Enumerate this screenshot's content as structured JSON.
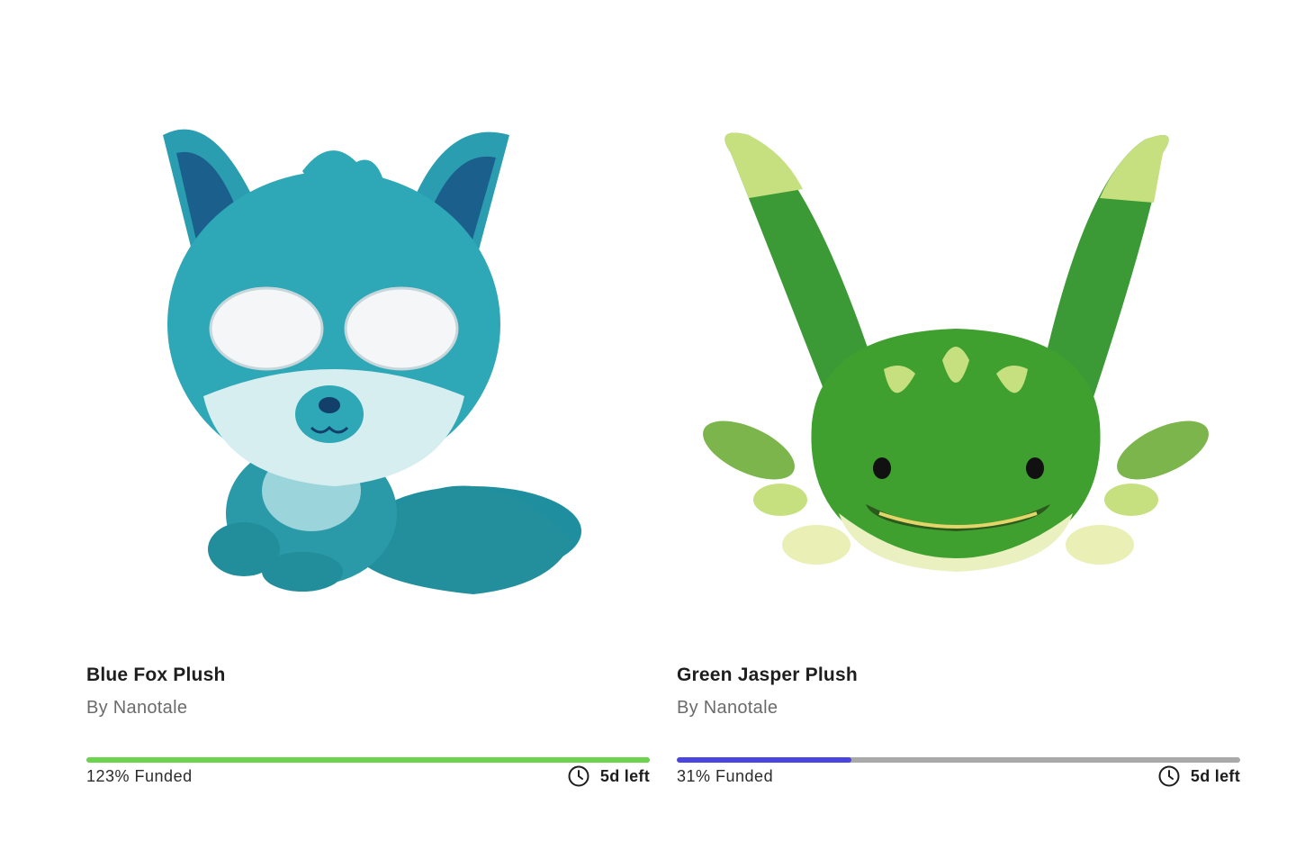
{
  "projects": [
    {
      "title": "Blue Fox Plush",
      "creator_label": "By Nanotale",
      "funded_label": "123% Funded",
      "funded_fraction": 1.0,
      "bar_color": "#6cd34d",
      "time_left": "5d left",
      "image_icon": "blue-fox-plush-image"
    },
    {
      "title": "Green Jasper Plush",
      "creator_label": "By Nanotale",
      "funded_label": "31% Funded",
      "funded_fraction": 0.31,
      "bar_color": "#4a45e0",
      "time_left": "5d left",
      "image_icon": "green-jasper-plush-image"
    }
  ],
  "colors": {
    "track": "#a9a9a9",
    "text_muted": "#6b6b6b"
  },
  "icons": {
    "clock": "clock-icon"
  }
}
